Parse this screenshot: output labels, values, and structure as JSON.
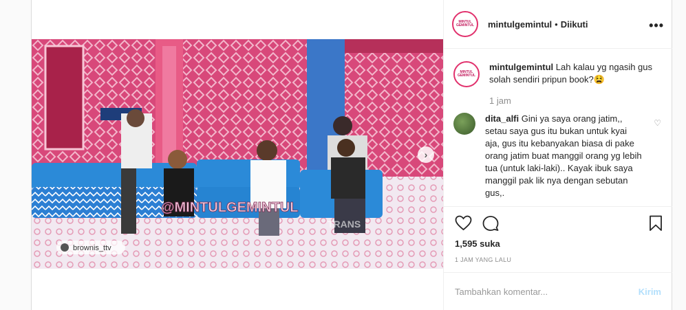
{
  "post": {
    "username": "mintulgemintul",
    "separator": "•",
    "follow_status": "Diikuti",
    "more": "•••",
    "avatar_text": "MINTUL GEMINTUL"
  },
  "video": {
    "watermark": "@MINTULGEMINTUL",
    "source_tag": "brownis_ttv",
    "channel_text": "TRANS",
    "next_icon": "›"
  },
  "caption": {
    "username": "mintulgemintul",
    "text": "Lah kalau yg ngasih gus solah sendiri pripun book?",
    "emoji": "😫",
    "time": "1 jam"
  },
  "comments": [
    {
      "username": "dita_alfi",
      "text": "Gini ya saya orang jatim,, setau saya gus itu bukan untuk kyai aja, gus itu kebanyakan biasa di pake orang jatim buat manggil orang yg lebih tua (untuk laki-laki).. Kayak ibuk saya manggil pak lik nya dengan sebutan gus,."
    }
  ],
  "stats": {
    "likes": "1,595 suka",
    "time_ago": "1 JAM YANG LALU"
  },
  "compose": {
    "placeholder": "Tambahkan komentar...",
    "send_label": "Kirim"
  }
}
